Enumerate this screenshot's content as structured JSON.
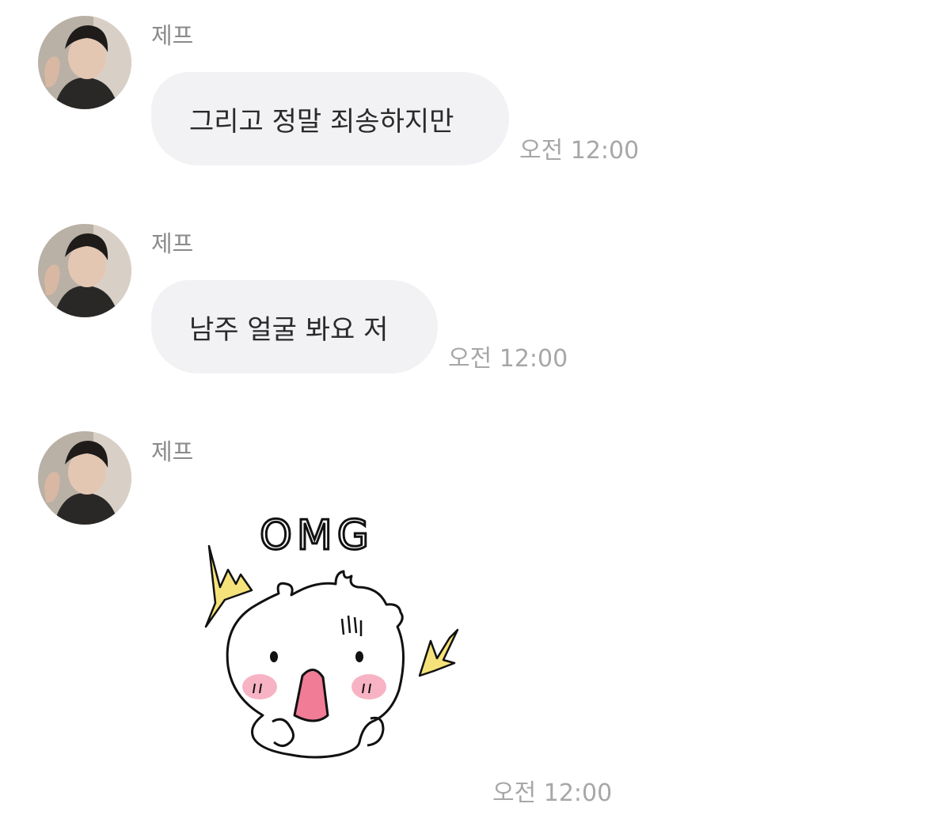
{
  "messages": [
    {
      "sender": "제프",
      "type": "text",
      "text": "그리고 정말 죄송하지만",
      "time": "오전 12:00"
    },
    {
      "sender": "제프",
      "type": "text",
      "text": "남주 얼굴 봐요 저",
      "time": "오전 12:00"
    },
    {
      "sender": "제프",
      "type": "sticker",
      "sticker_text": "OMG",
      "time": "오전 12:00"
    }
  ],
  "colors": {
    "bubble": "#f2f2f5",
    "sender": "#8a8a8a",
    "time": "#a7a7a7",
    "spark": "#f5e27a",
    "blush": "#f7b3c4"
  },
  "icons": {
    "avatar": "profile-photo",
    "sticker": "surprised-hamster-sticker"
  }
}
